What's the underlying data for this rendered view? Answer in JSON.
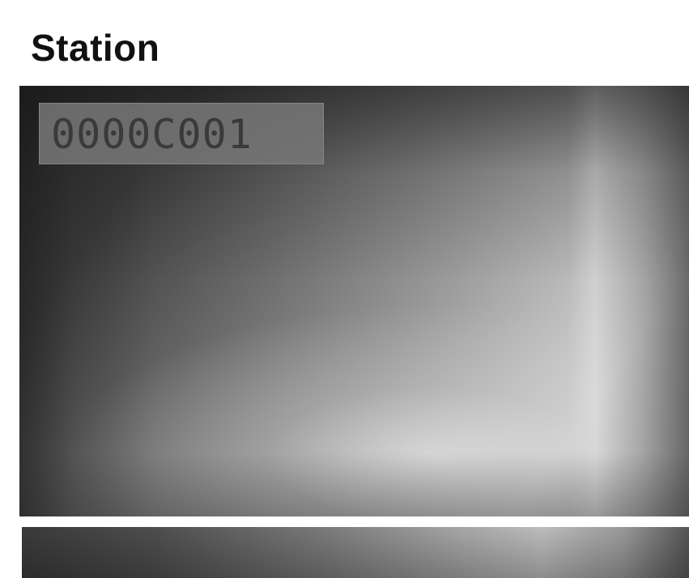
{
  "section": {
    "title": "Station"
  },
  "display": {
    "station_id": "0000C001"
  },
  "colors": {
    "title_text": "#111111",
    "station_text": "#3a3a3a",
    "station_box": "#787878",
    "screen_dark": "#2a2a2a",
    "screen_light": "#d4d4d4"
  }
}
